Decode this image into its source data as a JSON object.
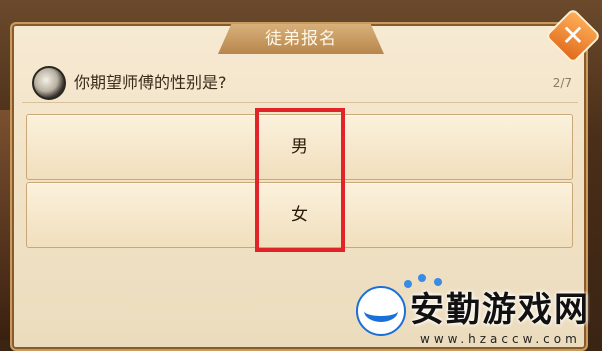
{
  "dialog": {
    "title": "徒弟报名",
    "question": "你期望师傅的性别是?",
    "progress": "2/7",
    "options": [
      {
        "label": "男"
      },
      {
        "label": "女"
      }
    ]
  },
  "watermark": {
    "text": "安勤游戏网",
    "url": "www.hzaccw.com"
  },
  "colors": {
    "highlight": "#e0242a",
    "close_button": "#e06a1c",
    "dialog_bg": "#f1e2c6"
  },
  "icons": {
    "close": "close-icon",
    "avatar": "master-avatar-icon"
  }
}
